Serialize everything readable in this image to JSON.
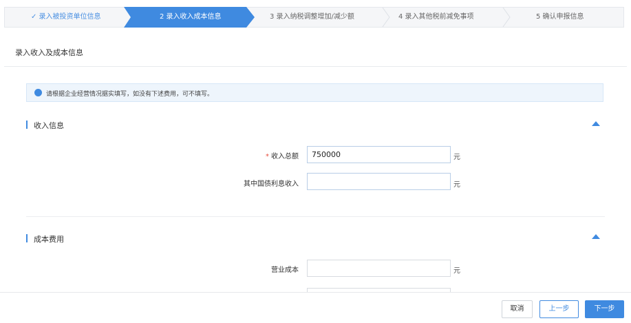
{
  "stepper": {
    "steps": [
      {
        "label": "✓ 录入被投资单位信息",
        "state": "done"
      },
      {
        "label": "2 录入收入成本信息",
        "state": "active"
      },
      {
        "label": "3 录入纳税调整增加/减少额",
        "state": "pending"
      },
      {
        "label": "4 录入其他税前减免事项",
        "state": "pending"
      },
      {
        "label": "5 确认申报信息",
        "state": "pending"
      }
    ]
  },
  "panel": {
    "title": "录入收入及成本信息",
    "notice": "请根据企业经营情况据实填写，如没有下述费用，可不填写。"
  },
  "income_section": {
    "title": "收入信息",
    "fields": [
      {
        "required_mark": "*",
        "label": "收入总额",
        "value": "750000",
        "unit": "元"
      },
      {
        "label": "其中国债利息收入",
        "value": "",
        "unit": "元"
      }
    ]
  },
  "cost_section": {
    "title": "成本费用",
    "fields": [
      {
        "label": "营业成本",
        "value": "",
        "unit": "元"
      }
    ]
  },
  "footer": {
    "cancel_label": "取消",
    "prev_label": "上一步",
    "next_label": "下一步"
  },
  "colors": {
    "accent": "#3f8ae0",
    "required": "#e74c3c",
    "notice_bg": "#eef5fc"
  }
}
